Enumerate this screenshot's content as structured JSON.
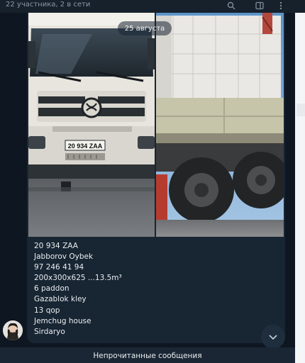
{
  "header": {
    "subtitle": "22 участника, 2 в сети",
    "icons": [
      "search-icon",
      "sidebar-toggle-icon",
      "more-vertical-icon"
    ]
  },
  "message": {
    "date_badge": "25 августа",
    "plate": "20 934 ZAA",
    "caption_lines": [
      "20 934 ZAA",
      "Jabborov Oybek",
      "97 246 41 94",
      "200x300x625 ...13.5m³",
      "6 paddon",
      "Gazablok kley",
      "13 qop",
      "Jemchug house",
      "Sirdaryo"
    ]
  },
  "footer": {
    "unread_label": "Непрочитанные сообщения"
  },
  "colors": {
    "background": "#0e1621",
    "bubble": "#182533",
    "header": "#17212b",
    "text": "#e9edf1",
    "muted": "#8a98a6"
  }
}
